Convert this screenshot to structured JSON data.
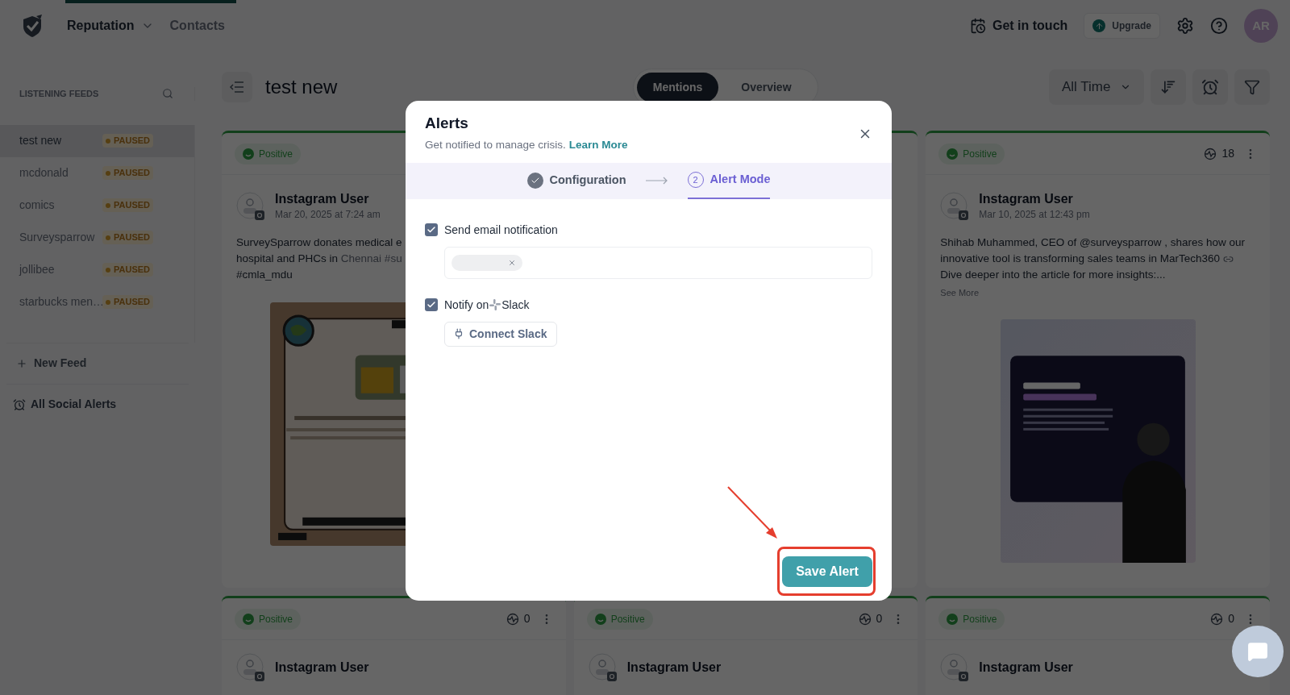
{
  "top_nav": {
    "tabs": [
      {
        "label": "Reputation",
        "selected": true,
        "has_menu": true
      },
      {
        "label": "Contacts",
        "selected": false,
        "has_menu": false
      }
    ],
    "get_in_touch": "Get in touch",
    "upgrade": "Upgrade",
    "avatar": "AR"
  },
  "sidebar": {
    "title": "LISTENING FEEDS",
    "feeds": [
      {
        "name": "test new",
        "status": "PAUSED",
        "selected": true
      },
      {
        "name": "mcdonald",
        "status": "PAUSED",
        "selected": false
      },
      {
        "name": "comics",
        "status": "PAUSED",
        "selected": false
      },
      {
        "name": "Surveysparrow",
        "status": "PAUSED",
        "selected": false
      },
      {
        "name": "jollibee",
        "status": "PAUSED",
        "selected": false
      },
      {
        "name": "starbucks men…",
        "status": "PAUSED",
        "selected": false
      }
    ],
    "new_feed": "New Feed",
    "all_alerts": "All Social Alerts"
  },
  "header": {
    "title": "test new",
    "tabs": [
      {
        "label": "Mentions",
        "selected": true
      },
      {
        "label": "Overview",
        "selected": false
      }
    ],
    "time_range": "All Time"
  },
  "posts_top": [
    {
      "sentiment": "Positive",
      "user": "Instagram User",
      "date": "Mar 20, 2025 at 7:24 am",
      "lines": [
        {
          "segments": [
            {
              "text": "SurveySparrow donates medical e",
              "highlight": false
            }
          ]
        },
        {
          "segments": [
            {
              "text": "hospital and PHCs in ",
              "highlight": false
            },
            {
              "text": "Chennai #su",
              "highlight": true
            }
          ]
        },
        {
          "segments": [
            {
              "text": "#cmla_mdu",
              "highlight": false
            }
          ]
        }
      ]
    },
    {
      "sentiment": "Positive",
      "count": "18",
      "user": "Instagram User",
      "date": "Mar 10, 2025 at 12:43 pm",
      "lines": [
        {
          "link_icon": false,
          "segments": [
            {
              "text": "Shihab Muhammed, CEO of @surveysparrow , shares how our",
              "highlight": false
            }
          ]
        },
        {
          "link_icon": true,
          "segments": [
            {
              "text": "innovative tool is transforming sales teams in MarTech360",
              "highlight": false
            }
          ]
        },
        {
          "link_icon": false,
          "segments": [
            {
              "text": "Dive deeper into the article for more insights:...",
              "highlight": false
            }
          ]
        }
      ],
      "see_more": "See More"
    }
  ],
  "posts_bottom": [
    {
      "sentiment": "Positive",
      "count": "0",
      "user": "Instagram User"
    },
    {
      "sentiment": "Positive",
      "count": "0",
      "user": "Instagram User"
    },
    {
      "sentiment": "Positive",
      "count": "0",
      "user": "Instagram User"
    }
  ],
  "modal": {
    "title": "Alerts",
    "subtitle": "Get notified to manage crisis.",
    "learn_more": "Learn More",
    "steps": [
      {
        "label": "Configuration",
        "done": true,
        "selected": false
      },
      {
        "label": "Alert Mode",
        "number": "2",
        "done": false,
        "selected": true
      }
    ],
    "options": [
      {
        "kind": "email",
        "label": "Send email notification",
        "checked": true
      },
      {
        "kind": "slack",
        "label_before": "Notify on",
        "label_after": "Slack",
        "checked": true,
        "action": "Connect Slack"
      }
    ],
    "save": "Save Alert"
  }
}
